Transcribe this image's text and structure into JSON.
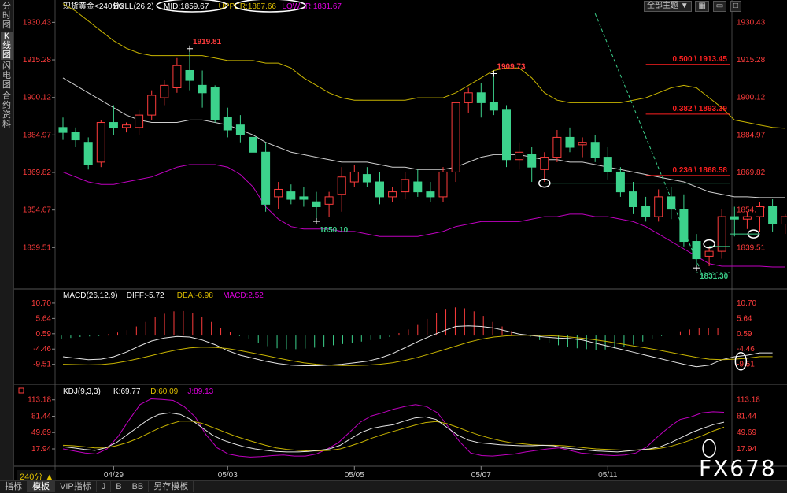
{
  "sidebar": {
    "tabs": [
      {
        "label": "分时图",
        "active": false
      },
      {
        "label": "K线图",
        "active": true
      },
      {
        "label": "闪电图",
        "active": false
      },
      {
        "label": "合约资料",
        "active": false
      }
    ]
  },
  "toolbar": {
    "theme_label": "全部主题 ▼"
  },
  "timeframe": "240分 ▲",
  "bottom_tabs": [
    "指标",
    "模板",
    "VIP指标",
    "J",
    "B",
    "BB",
    "另存模板"
  ],
  "watermark": "FX678",
  "chart_data": {
    "type": "candlestick",
    "colors": {
      "up": "#ff3c3c",
      "down": "#3cd28c",
      "mid": "#cfcfcf",
      "upper": "#c8b400",
      "lower": "#c000c0",
      "fib": "#ff2020",
      "support": "#3cd28c",
      "axis_text": "#ff3c3c"
    },
    "main": {
      "header": [
        {
          "text": "现货黄金<240分>",
          "color": "#ffffff"
        },
        {
          "text": "BOLL(26,2)",
          "color": "#ffffff"
        },
        {
          "text": "MID:1859.67",
          "color": "#ffffff"
        },
        {
          "text": "UPPER:1887.66",
          "color": "#e0c000"
        },
        {
          "text": "LOWER:1831.67",
          "color": "#e000e0"
        }
      ],
      "ylim": [
        1825,
        1935
      ],
      "ticks": [
        "1930.43",
        "1915.28",
        "1900.12",
        "1884.97",
        "1869.82",
        "1854.67",
        "1839.51"
      ],
      "tick_values": [
        1930.43,
        1915.28,
        1900.12,
        1884.97,
        1869.82,
        1854.67,
        1839.51
      ],
      "x_labels": [
        {
          "i": 4,
          "text": "04/29"
        },
        {
          "i": 13,
          "text": "05/03"
        },
        {
          "i": 23,
          "text": "05/05"
        },
        {
          "i": 33,
          "text": "05/07"
        },
        {
          "i": 43,
          "text": "05/11"
        }
      ],
      "candles": [
        [
          1888,
          1892,
          1883,
          1886
        ],
        [
          1886,
          1888,
          1880,
          1883
        ],
        [
          1882,
          1884,
          1871,
          1873
        ],
        [
          1874,
          1891,
          1872,
          1890
        ],
        [
          1890,
          1897,
          1885,
          1888
        ],
        [
          1888,
          1890,
          1886,
          1889
        ],
        [
          1888,
          1895,
          1885,
          1893
        ],
        [
          1893,
          1903,
          1891,
          1901
        ],
        [
          1900,
          1907,
          1897,
          1905
        ],
        [
          1904,
          1916,
          1902,
          1913
        ],
        [
          1911,
          1919.81,
          1903,
          1907
        ],
        [
          1905,
          1911,
          1896,
          1902
        ],
        [
          1904,
          1905,
          1890,
          1891
        ],
        [
          1892,
          1896,
          1884,
          1887
        ],
        [
          1889,
          1893,
          1882,
          1885
        ],
        [
          1884,
          1888,
          1876,
          1878
        ],
        [
          1878,
          1882,
          1854,
          1857
        ],
        [
          1860,
          1866,
          1855,
          1863
        ],
        [
          1862,
          1865,
          1857,
          1859
        ],
        [
          1860,
          1864,
          1856,
          1859
        ],
        [
          1858,
          1862,
          1850.1,
          1856
        ],
        [
          1857,
          1862,
          1852,
          1860
        ],
        [
          1861,
          1872,
          1854,
          1868
        ],
        [
          1866,
          1873,
          1864,
          1870
        ],
        [
          1869,
          1872,
          1864,
          1866
        ],
        [
          1866,
          1870,
          1857,
          1860
        ],
        [
          1860,
          1864,
          1858,
          1862
        ],
        [
          1862,
          1870,
          1859,
          1867
        ],
        [
          1866,
          1871,
          1860,
          1862
        ],
        [
          1862,
          1866,
          1858,
          1860
        ],
        [
          1860,
          1872,
          1858,
          1870
        ],
        [
          1870,
          1893,
          1866,
          1898
        ],
        [
          1898,
          1904,
          1894,
          1902
        ],
        [
          1902,
          1906,
          1892,
          1898
        ],
        [
          1898,
          1909.73,
          1893,
          1895
        ],
        [
          1895,
          1897,
          1872,
          1875
        ],
        [
          1875,
          1882,
          1871,
          1878
        ],
        [
          1877,
          1880,
          1866,
          1872
        ],
        [
          1871,
          1878,
          1866,
          1876
        ],
        [
          1876,
          1887,
          1874,
          1884
        ],
        [
          1884,
          1888,
          1878,
          1880
        ],
        [
          1881,
          1884,
          1876,
          1882
        ],
        [
          1882,
          1885,
          1874,
          1876
        ],
        [
          1876,
          1880,
          1867,
          1870
        ],
        [
          1870,
          1872,
          1860,
          1862
        ],
        [
          1862,
          1866,
          1853,
          1856
        ],
        [
          1856,
          1860,
          1850,
          1852
        ],
        [
          1852,
          1863,
          1850,
          1860
        ],
        [
          1860,
          1864,
          1851,
          1855
        ],
        [
          1855,
          1861,
          1840,
          1842
        ],
        [
          1842,
          1845,
          1831.3,
          1835
        ],
        [
          1836,
          1840,
          1832,
          1838
        ],
        [
          1838,
          1855,
          1835,
          1852
        ],
        [
          1852,
          1856,
          1844,
          1851
        ],
        [
          1851,
          1854,
          1847,
          1852
        ],
        [
          1852,
          1858,
          1846,
          1856
        ],
        [
          1856,
          1859,
          1846,
          1849
        ],
        [
          1849,
          1853,
          1845,
          1852
        ]
      ],
      "boll_mid": [
        1908,
        1905,
        1902,
        1899,
        1896,
        1893,
        1891,
        1890,
        1890,
        1890,
        1891,
        1891,
        1890,
        1889,
        1887,
        1885,
        1882,
        1880,
        1878,
        1877,
        1876,
        1875,
        1874,
        1874,
        1874,
        1873,
        1872,
        1872,
        1871,
        1871,
        1871,
        1872,
        1874,
        1876,
        1877,
        1877,
        1877,
        1876,
        1875,
        1875,
        1874,
        1874,
        1873,
        1872,
        1871,
        1870,
        1869,
        1868,
        1867,
        1866,
        1864,
        1862,
        1861,
        1860,
        1860,
        1859.67,
        1859.67,
        1859.67
      ],
      "boll_upper": [
        1938,
        1935,
        1931,
        1927,
        1923,
        1920,
        1918,
        1917,
        1917,
        1917,
        1917,
        1917,
        1916,
        1915,
        1915,
        1915,
        1914,
        1914,
        1912,
        1908,
        1905,
        1902,
        1900,
        1899,
        1899,
        1899,
        1899,
        1899,
        1900,
        1900,
        1900,
        1902,
        1905,
        1908,
        1911,
        1912,
        1912,
        1908,
        1902,
        1899,
        1898,
        1898,
        1898,
        1898,
        1898,
        1899,
        1900,
        1902,
        1904,
        1905,
        1904,
        1900,
        1896,
        1891,
        1890,
        1889,
        1888,
        1887.66
      ],
      "boll_lower": [
        1870,
        1868,
        1866,
        1865,
        1865,
        1866,
        1867,
        1868,
        1870,
        1872,
        1873,
        1873,
        1873,
        1872,
        1869,
        1864,
        1856,
        1851,
        1848,
        1847,
        1847,
        1847,
        1846,
        1846,
        1845,
        1844,
        1844,
        1844,
        1844,
        1845,
        1846,
        1848,
        1849,
        1850,
        1850,
        1850,
        1850,
        1851,
        1852,
        1852,
        1853,
        1853,
        1852,
        1852,
        1851,
        1850,
        1848,
        1845,
        1842,
        1839,
        1836,
        1833,
        1832,
        1832,
        1832,
        1832,
        1831.67,
        1831.67
      ],
      "labels": [
        {
          "i": 10,
          "value": 1919.81,
          "text": "1919.81",
          "color": "#ff3c3c",
          "pos": "above"
        },
        {
          "i": 34,
          "value": 1909.73,
          "text": "1909.73",
          "color": "#ff3c3c",
          "pos": "above"
        },
        {
          "i": 20,
          "value": 1850.1,
          "text": "1850.10",
          "color": "#3cd28c",
          "pos": "below"
        },
        {
          "i": 50,
          "value": 1831.3,
          "text": "1831.30",
          "color": "#3cd28c",
          "pos": "below"
        }
      ],
      "fib": [
        {
          "value": 1913.45,
          "text": "0.500 \\ 1913.45"
        },
        {
          "value": 1893.39,
          "text": "0.382 \\ 1893.39"
        },
        {
          "value": 1868.58,
          "text": "0.236 \\ 1868.58"
        }
      ],
      "support_lines": [
        {
          "value": 1865.5,
          "from": 38
        },
        {
          "value": 1845.0,
          "from": 55
        },
        {
          "value": 1840.0,
          "from": 51
        }
      ],
      "dotted_line": {
        "value": 1829.5,
        "from": 50
      },
      "trend_line": {
        "i0": 42,
        "v0": 1934,
        "i1": 50.5,
        "v1": 1828
      },
      "circles": [
        {
          "i": 38,
          "value": 1865.5
        },
        {
          "i": 51,
          "value": 1841
        },
        {
          "i": 54.5,
          "value": 1845
        }
      ]
    },
    "macd": {
      "header": [
        {
          "text": "MACD(26,12,9)",
          "color": "#ffffff"
        },
        {
          "text": "DIFF:-5.72",
          "color": "#ffffff"
        },
        {
          "text": "DEA:-6.98",
          "color": "#e0c000"
        },
        {
          "text": "MACD:2.52",
          "color": "#e000e0"
        }
      ],
      "ylim": [
        -13.5,
        12.5
      ],
      "ticks": [
        "10.70",
        "5.64",
        "0.59",
        "-4.46",
        "-9.51"
      ],
      "tick_values": [
        10.7,
        5.64,
        0.59,
        -4.46,
        -9.51
      ],
      "hist": [
        -1.2,
        -0.8,
        -0.5,
        -0.3,
        -0.2,
        0.4,
        1.0,
        1.8,
        3.0,
        4.5,
        6.0,
        7.2,
        8.0,
        8.1,
        7.4,
        6.0,
        4.5,
        2.5,
        1.2,
        -0.2,
        -1.0,
        -2.5,
        -3.5,
        -4.2,
        -4.5,
        -4.5,
        -4.3,
        -4.0,
        -3.6,
        -3.2,
        -2.8,
        -2.4,
        -2.0,
        -1.5,
        -1.0,
        -0.5,
        0.8,
        2.0,
        3.5,
        5.5,
        7.5,
        8.8,
        9.3,
        9.0,
        8.0,
        6.5,
        4.5,
        3.0,
        1.5,
        0.5,
        -0.5,
        -1.5,
        -2.5,
        -3.2,
        -3.8,
        -4.2,
        -4.5,
        -4.7,
        -4.6,
        -4.3,
        -3.8,
        -3.0,
        -2.0,
        -1.0,
        -0.2,
        0.6,
        1.4,
        2.0,
        2.4,
        2.5,
        2.52
      ],
      "diff": [
        -7,
        -7.5,
        -8,
        -7.8,
        -7,
        -5.5,
        -3.5,
        -1.8,
        -0.8,
        -0.3,
        -0.5,
        -1.5,
        -3,
        -5,
        -6.5,
        -7.5,
        -8.5,
        -9.3,
        -9.8,
        -10,
        -10,
        -9.8,
        -9.5,
        -9,
        -8.5,
        -7.5,
        -6,
        -4,
        -2,
        -0.2,
        1.5,
        3,
        3.2,
        3,
        2.5,
        1.5,
        0.5,
        0,
        -0.5,
        -0.8,
        -1,
        -1.5,
        -2.5,
        -3.5,
        -4.5,
        -5.5,
        -6.5,
        -7.5,
        -8.5,
        -9.5,
        -10.3,
        -9.8,
        -8,
        -7,
        -6.5,
        -5.72,
        -5.72
      ],
      "dea": [
        -9.5,
        -9.6,
        -9.7,
        -9.6,
        -9.2,
        -8.5,
        -7.6,
        -6.6,
        -5.6,
        -4.7,
        -4.1,
        -3.8,
        -3.9,
        -4.3,
        -5,
        -5.8,
        -6.6,
        -7.5,
        -8.3,
        -9,
        -9.5,
        -9.8,
        -9.9,
        -9.9,
        -9.8,
        -9.5,
        -9,
        -8.2,
        -7.2,
        -6,
        -4.8,
        -3.5,
        -2.2,
        -1.2,
        -0.5,
        -0.1,
        0.1,
        0.1,
        0,
        -0.2,
        -0.5,
        -0.9,
        -1.4,
        -2,
        -2.7,
        -3.4,
        -4.1,
        -4.8,
        -5.6,
        -6.4,
        -7.2,
        -7.8,
        -8,
        -7.8,
        -7.5,
        -6.98,
        -6.98
      ],
      "circle": {
        "i": 53.5,
        "value": -8.5
      }
    },
    "kdj": {
      "header": [
        {
          "text": "KDJ(9,3,3)",
          "color": "#ffffff"
        },
        {
          "text": "K:69.77",
          "color": "#ffffff"
        },
        {
          "text": "D:60.09",
          "color": "#e0c000"
        },
        {
          "text": "J:89.13",
          "color": "#e000e0"
        }
      ],
      "ylim": [
        -5,
        125
      ],
      "ticks": [
        "113.18",
        "81.44",
        "49.69",
        "17.94"
      ],
      "tick_values": [
        113.18,
        81.44,
        49.69,
        17.94
      ],
      "k": [
        22,
        20,
        17,
        15,
        20,
        30,
        45,
        60,
        75,
        85,
        88,
        85,
        75,
        60,
        45,
        35,
        28,
        22,
        18,
        15,
        13,
        12,
        12,
        13,
        15,
        18,
        25,
        38,
        50,
        58,
        62,
        65,
        72,
        78,
        80,
        75,
        60,
        45,
        35,
        30,
        28,
        26,
        25,
        24,
        24,
        25,
        24,
        20,
        18,
        16,
        14,
        13,
        12,
        14,
        16,
        18,
        22,
        30,
        40,
        50,
        58,
        65,
        69.77
      ],
      "d": [
        25,
        24,
        22,
        20,
        20,
        24,
        30,
        38,
        48,
        58,
        66,
        72,
        72,
        68,
        60,
        52,
        44,
        37,
        31,
        25,
        20,
        17,
        15,
        14,
        14,
        15,
        18,
        24,
        31,
        39,
        46,
        52,
        58,
        64,
        69,
        71,
        67,
        60,
        52,
        45,
        39,
        34,
        30,
        28,
        26,
        25,
        25,
        24,
        22,
        20,
        18,
        17,
        16,
        15,
        16,
        17,
        19,
        23,
        29,
        36,
        44,
        53,
        60.09
      ],
      "j": [
        18,
        14,
        10,
        8,
        18,
        42,
        74,
        104,
        115,
        114,
        112,
        100,
        80,
        45,
        20,
        8,
        4,
        2,
        3,
        5,
        6,
        4,
        4,
        8,
        18,
        30,
        50,
        70,
        82,
        88,
        95,
        100,
        104,
        100,
        88,
        60,
        32,
        10,
        5,
        4,
        6,
        8,
        12,
        15,
        18,
        20,
        15,
        10,
        8,
        6,
        5,
        6,
        10,
        22,
        42,
        60,
        75,
        80,
        88,
        90,
        89.13
      ],
      "circle": {
        "i": 51,
        "value": 19
      }
    }
  }
}
